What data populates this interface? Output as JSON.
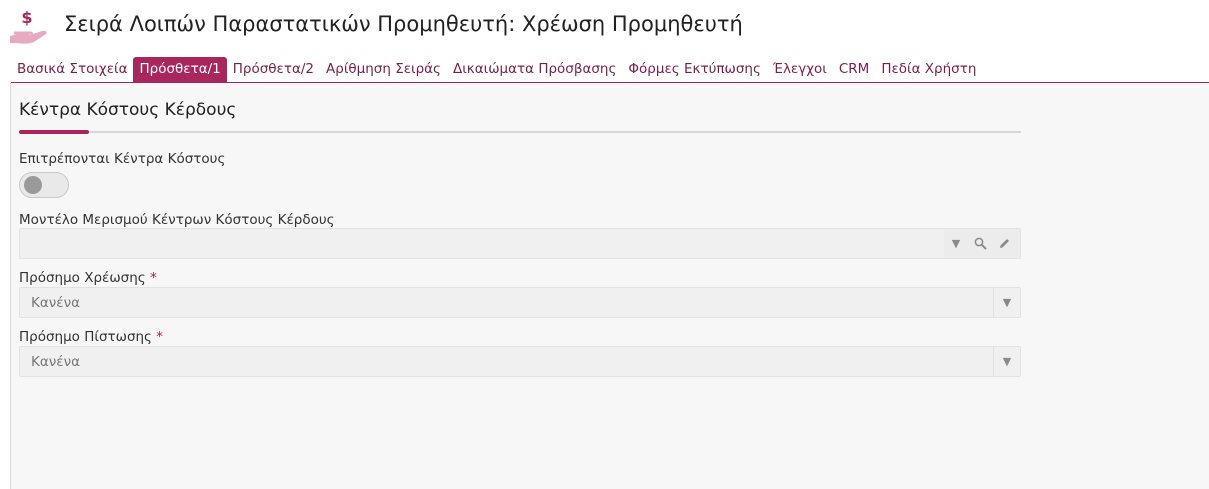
{
  "page": {
    "title": "Σειρά Λοιπών Παραστατικών Προμηθευτή: Χρέωση Προμηθευτή",
    "logo_icon": "money-hand-icon",
    "accent_color": "#a8265c"
  },
  "tabs": [
    {
      "label": "Βασικά Στοιχεία",
      "active": false
    },
    {
      "label": "Πρόσθετα/1",
      "active": true
    },
    {
      "label": "Πρόσθετα/2",
      "active": false
    },
    {
      "label": "Αρίθμηση Σειράς",
      "active": false
    },
    {
      "label": "Δικαιώματα Πρόσβασης",
      "active": false
    },
    {
      "label": "Φόρμες Εκτύπωσης",
      "active": false
    },
    {
      "label": "Έλεγχοι",
      "active": false
    },
    {
      "label": "CRM",
      "active": false
    },
    {
      "label": "Πεδία Χρήστη",
      "active": false
    }
  ],
  "section": {
    "title": "Κέντρα Κόστους Κέρδους"
  },
  "fields": {
    "allow_cost_centers": {
      "label": "Επιτρέπονται Κέντρα Κόστους",
      "value": false
    },
    "allocation_model": {
      "label": "Μοντέλο Μερισμού Κέντρων Κόστους Κέρδους",
      "value": ""
    },
    "debit_sign": {
      "label": "Πρόσημο Χρέωσης",
      "required_mark": "*",
      "value": "Κανένα"
    },
    "credit_sign": {
      "label": "Πρόσημο Πίστωσης",
      "required_mark": "*",
      "value": "Κανένα"
    }
  }
}
